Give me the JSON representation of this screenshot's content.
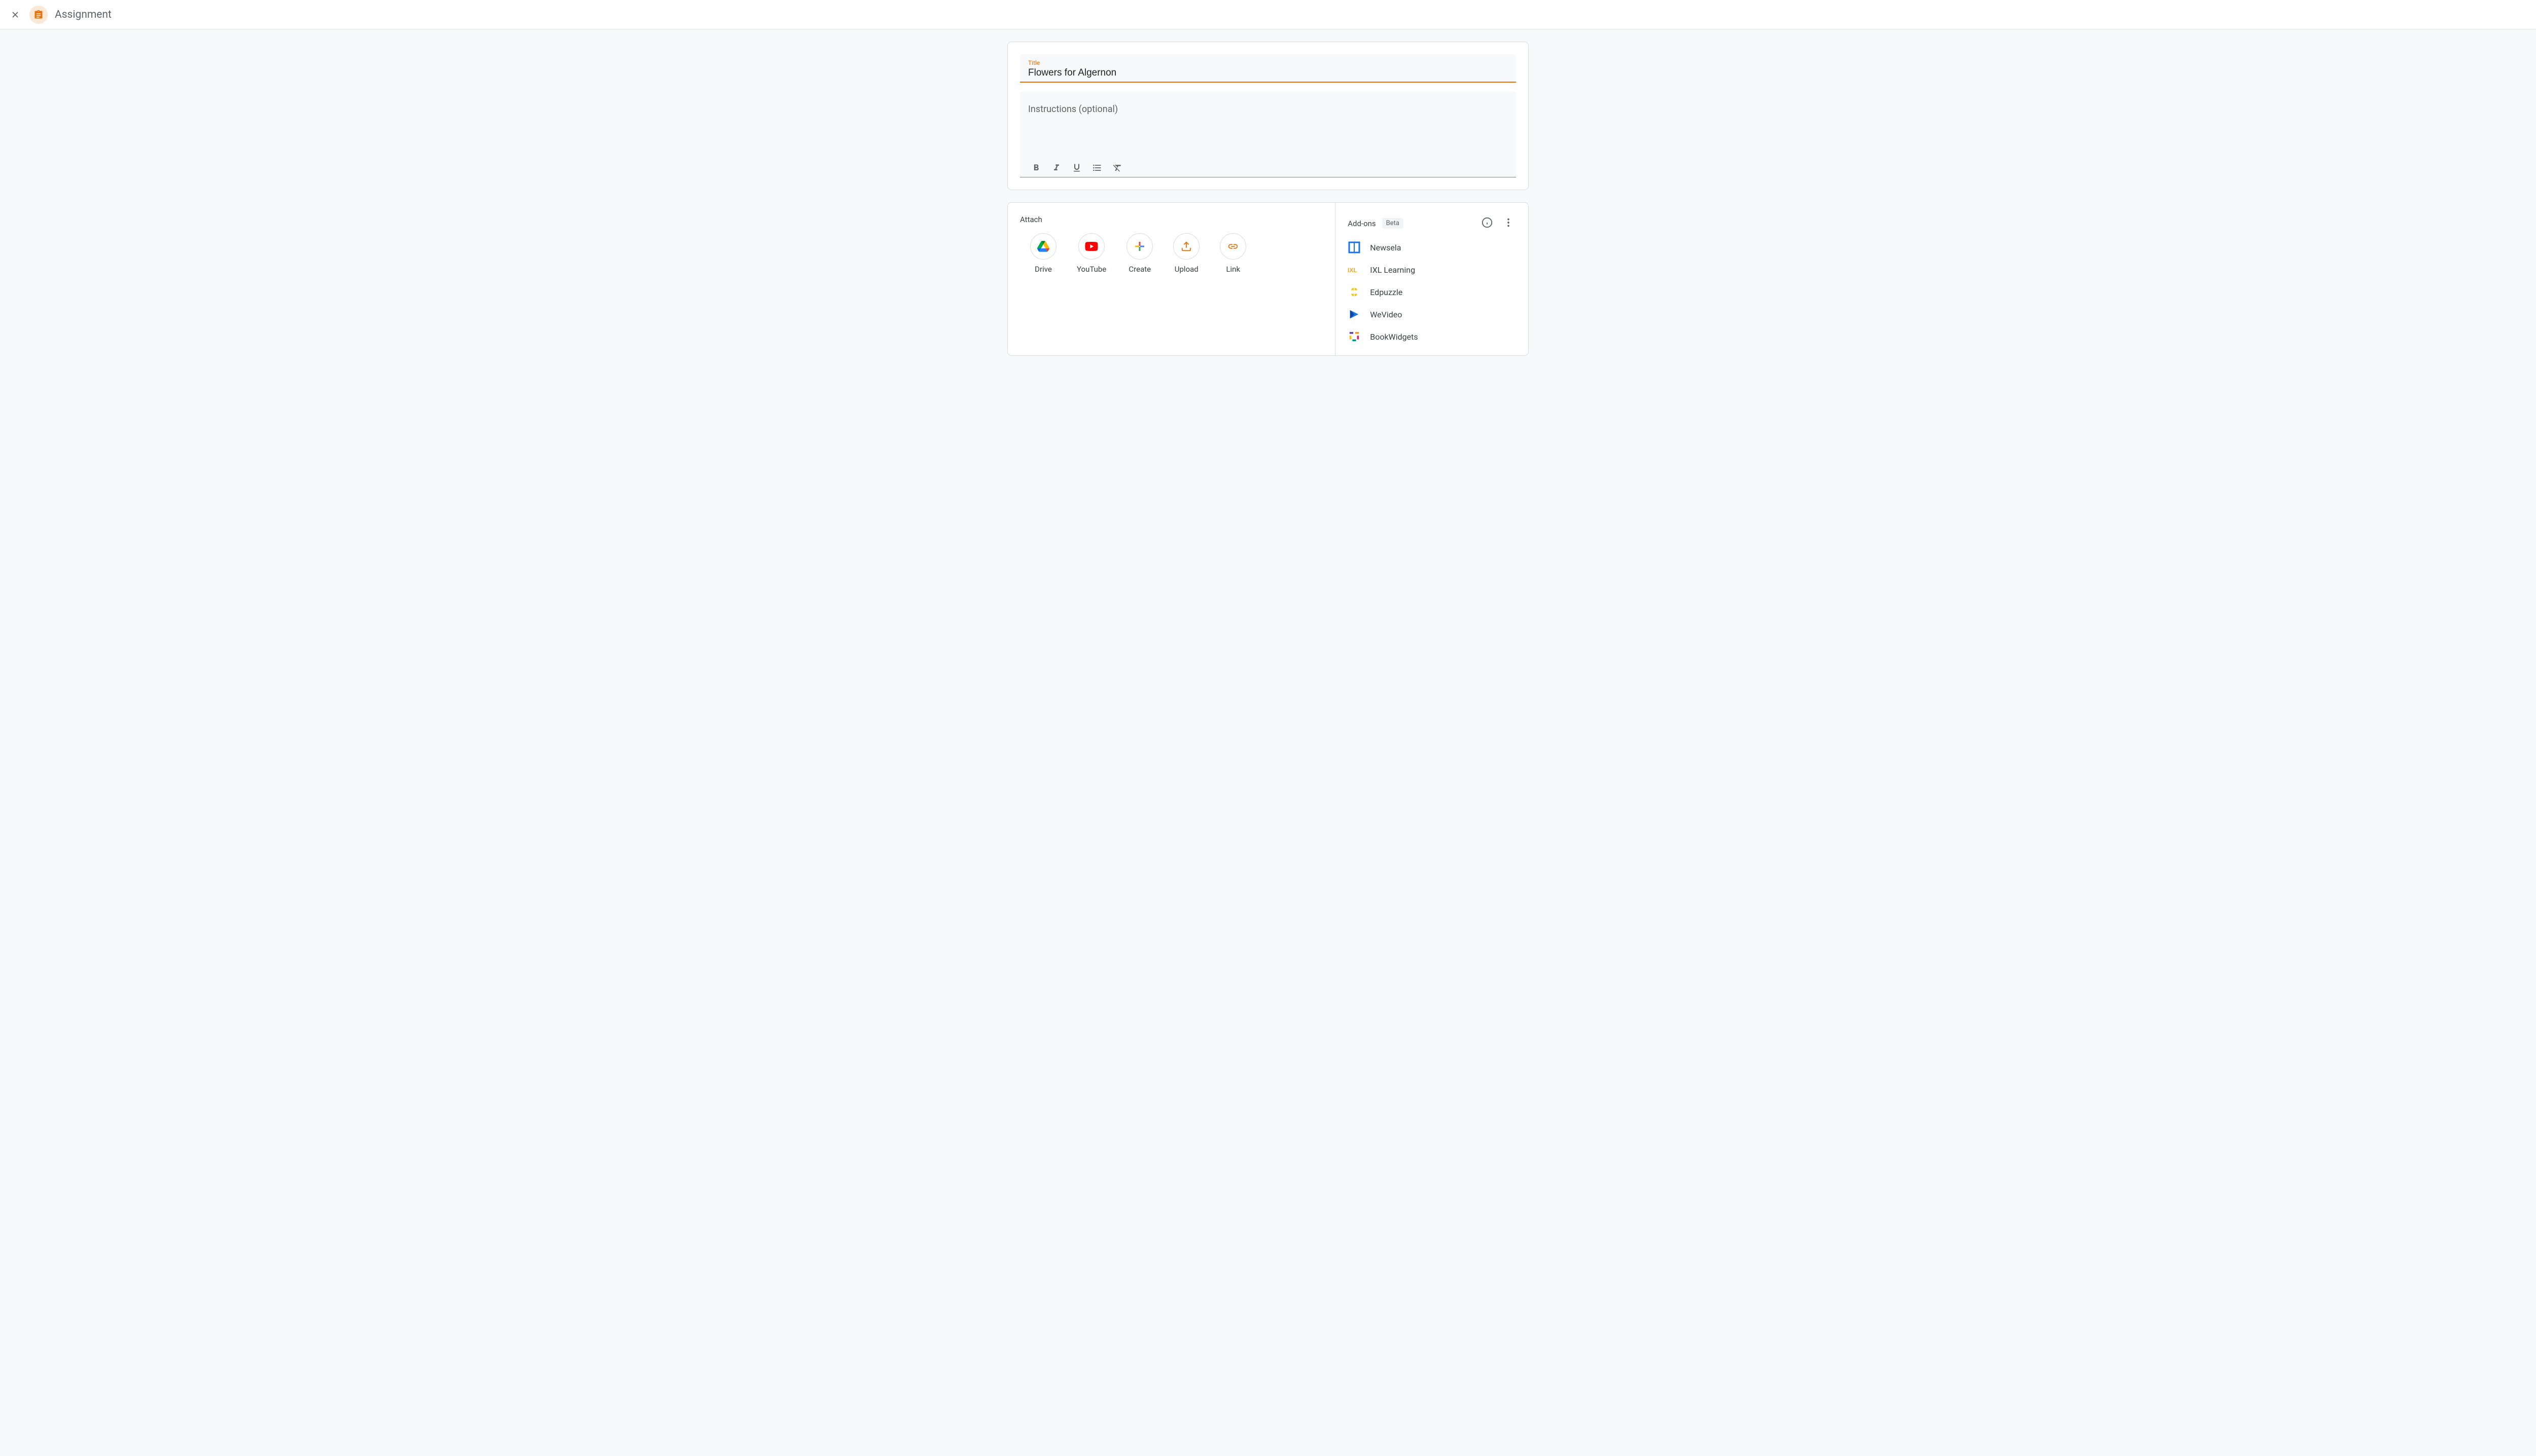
{
  "header": {
    "title": "Assignment"
  },
  "title_field": {
    "label": "Title",
    "value": "Flowers for Algernon"
  },
  "instructions": {
    "placeholder": "Instructions (optional)",
    "value": ""
  },
  "attach": {
    "heading": "Attach",
    "options": [
      {
        "label": "Drive",
        "icon": "drive"
      },
      {
        "label": "YouTube",
        "icon": "youtube"
      },
      {
        "label": "Create",
        "icon": "create"
      },
      {
        "label": "Upload",
        "icon": "upload"
      },
      {
        "label": "Link",
        "icon": "link"
      }
    ]
  },
  "addons": {
    "heading": "Add-ons",
    "badge": "Beta",
    "items": [
      {
        "label": "Newsela",
        "icon": "newsela"
      },
      {
        "label": "IXL Learning",
        "icon": "ixl"
      },
      {
        "label": "Edpuzzle",
        "icon": "edpuzzle"
      },
      {
        "label": "WeVideo",
        "icon": "wevideo"
      },
      {
        "label": "BookWidgets",
        "icon": "bookwidgets"
      }
    ]
  }
}
